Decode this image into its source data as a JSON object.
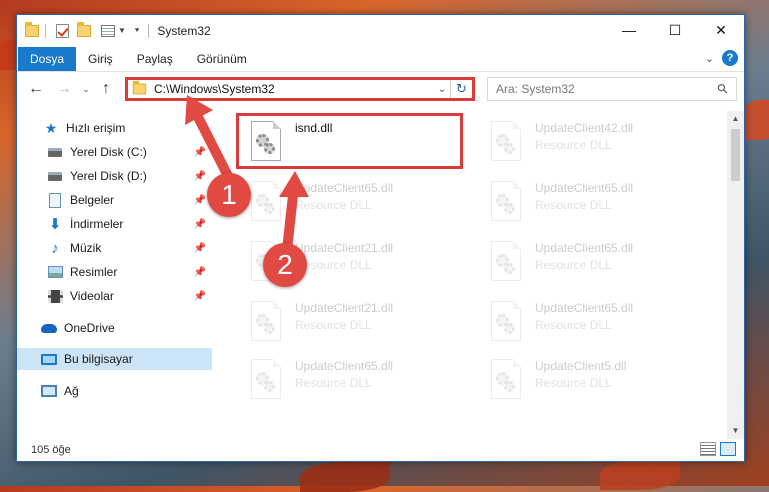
{
  "window": {
    "title": "System32",
    "controls": {
      "minimize": "—",
      "maximize": "☐",
      "close": "✕"
    }
  },
  "ribbon": {
    "tabs": [
      "Dosya",
      "Giriş",
      "Paylaş",
      "Görünüm"
    ],
    "active_tab": "Dosya"
  },
  "navigation": {
    "address_path": "C:\\Windows\\System32",
    "search_placeholder": "Ara: System32"
  },
  "sidebar": {
    "items": [
      {
        "label": "Hızlı erişim",
        "icon": "star-icon",
        "pinned": false
      },
      {
        "label": "Yerel Disk (C:)",
        "icon": "drive-icon",
        "pinned": true
      },
      {
        "label": "Yerel Disk (D:)",
        "icon": "drive-icon",
        "pinned": true
      },
      {
        "label": "Belgeler",
        "icon": "documents-icon",
        "pinned": true
      },
      {
        "label": "İndirmeler",
        "icon": "download-icon",
        "pinned": true
      },
      {
        "label": "Müzik",
        "icon": "music-icon",
        "pinned": true
      },
      {
        "label": "Resimler",
        "icon": "pictures-icon",
        "pinned": true
      },
      {
        "label": "Videolar",
        "icon": "videos-icon",
        "pinned": true
      },
      {
        "label": "OneDrive",
        "icon": "cloud-icon",
        "pinned": false
      },
      {
        "label": "Bu bilgisayar",
        "icon": "computer-icon",
        "pinned": false,
        "selected": true
      },
      {
        "label": "Ağ",
        "icon": "network-icon",
        "pinned": false
      }
    ]
  },
  "files": [
    {
      "name": "isnd.dll",
      "type": ""
    },
    {
      "name": "UpdateClient42.dll",
      "type": "Resource DLL"
    },
    {
      "name": "UpdateClient65.dll",
      "type": "Resource DLL"
    },
    {
      "name": "UpdateClient65.dll",
      "type": "Resource DLL"
    },
    {
      "name": "UpdateClient21.dll",
      "type": "Resource DLL"
    },
    {
      "name": "UpdateClient65.dll",
      "type": "Resource DLL"
    },
    {
      "name": "UpdateClient21.dll",
      "type": "Resource DLL"
    },
    {
      "name": "UpdateClient65.dll",
      "type": "Resource DLL"
    },
    {
      "name": "UpdateClient65.dll",
      "type": "Resource DLL"
    },
    {
      "name": "UpdateClient5.dll",
      "type": "Resource DLL"
    }
  ],
  "status": {
    "item_count": "105 öğe"
  },
  "annotations": {
    "step1": "1",
    "step2": "2",
    "highlight_color": "#d93a3a"
  }
}
